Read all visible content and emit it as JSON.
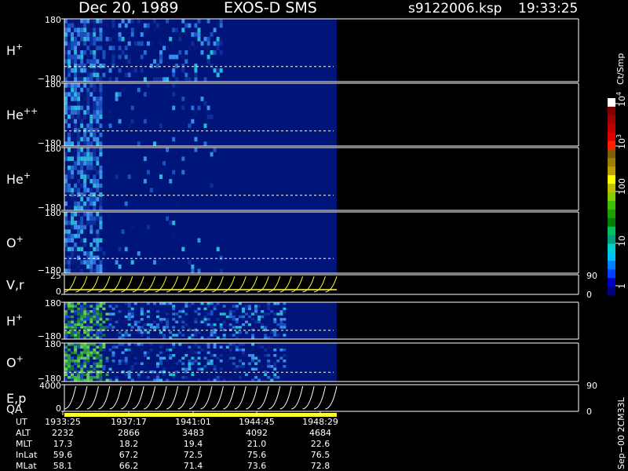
{
  "header": {
    "date": "Dec 20, 1989",
    "instrument": "EXOS-D SMS",
    "file": "s9122006.ksp",
    "time": "19:33:25"
  },
  "colorbar": {
    "unit": "Ct/Smp",
    "ticks": [
      "1",
      "10",
      "100",
      "10",
      "10"
    ],
    "tick_superscripts": [
      "",
      "",
      "",
      "3",
      "4"
    ],
    "colors": [
      "#000080",
      "#0000c0",
      "#0040ff",
      "#0080ff",
      "#00c0ff",
      "#00d0d0",
      "#00a080",
      "#00c060",
      "#008000",
      "#20a000",
      "#40c000",
      "#80d000",
      "#c0c000",
      "#ffff00",
      "#c0a000",
      "#a08000",
      "#806000",
      "#ff2000",
      "#e00000",
      "#c00000",
      "#a00000",
      "#800000",
      "#ffffff"
    ]
  },
  "panels": [
    {
      "label": "H",
      "sup": "+",
      "ymax": "180",
      "ymin": "−180"
    },
    {
      "label": "He",
      "sup": "++",
      "ymax": "180",
      "ymin": "−180"
    },
    {
      "label": "He",
      "sup": "+",
      "ymax": "180",
      "ymin": "−180"
    },
    {
      "label": "O",
      "sup": "+",
      "ymax": "180",
      "ymin": "−180"
    },
    {
      "label": "V,r",
      "sup": "",
      "ymax": "25",
      "ymin": "0",
      "right_max": "90",
      "right_min": "0"
    },
    {
      "label": "H",
      "sup": "+",
      "ymax": "180",
      "ymin": "−180"
    },
    {
      "label": "O",
      "sup": "+",
      "ymax": "180",
      "ymin": "−180"
    },
    {
      "label": "E,p",
      "label2": "QA",
      "sup": "",
      "ymax": "4000",
      "ymin": "0",
      "right_max": "90",
      "right_min": "0"
    }
  ],
  "side_note": "Sep−00 2CM33L",
  "ephemeris": {
    "labels": [
      "UT",
      "ALT",
      "MLT",
      "InLat",
      "MLat"
    ],
    "columns": [
      [
        "1933:25",
        "2232",
        "17.3",
        "59.6",
        "58.1"
      ],
      [
        "1937:17",
        "2866",
        "18.2",
        "67.2",
        "66.2"
      ],
      [
        "1941:01",
        "3483",
        "19.4",
        "72.5",
        "71.4"
      ],
      [
        "1944:45",
        "4092",
        "21.0",
        "75.6",
        "73.6"
      ],
      [
        "1948:29",
        "4684",
        "22.6",
        "76.5",
        "72.8"
      ]
    ]
  },
  "chart_data": {
    "type": "heatmap",
    "title": "Dec 20, 1989   EXOS-D SMS",
    "x_ticks_ut": [
      "1933:25",
      "1937:17",
      "1941:01",
      "1944:45",
      "1948:29"
    ],
    "panels": [
      "H+",
      "He++",
      "He+",
      "O+",
      "V,r",
      "H+",
      "O+",
      "E,p"
    ],
    "y_ranges": [
      [
        -180,
        180
      ],
      [
        -180,
        180
      ],
      [
        -180,
        180
      ],
      [
        -180,
        180
      ],
      [
        0,
        25
      ],
      [
        -180,
        180
      ],
      [
        -180,
        180
      ],
      [
        0,
        4000
      ]
    ],
    "right_axis_ranges": {
      "V,r": [
        0,
        90
      ],
      "E,p": [
        0,
        90
      ]
    },
    "colorbar_scale": "log",
    "colorbar_unit": "Ct/Smp"
  }
}
